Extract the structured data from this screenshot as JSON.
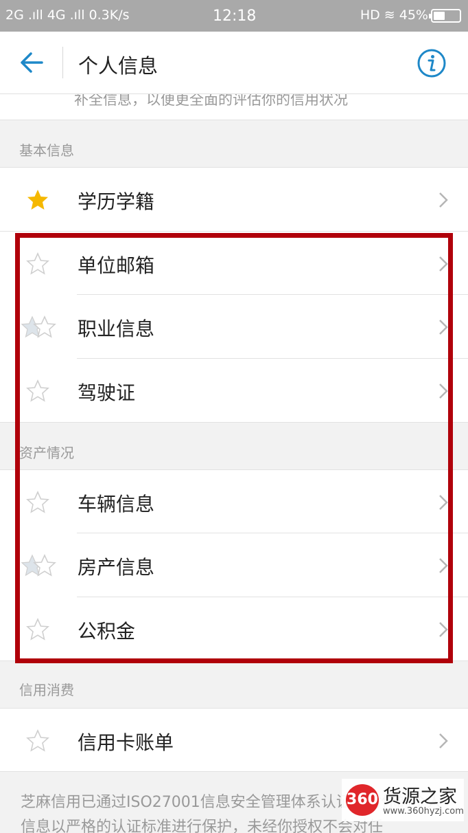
{
  "status_bar": {
    "left": "2G .ıll 4G .ıll 0.3K/s",
    "time": "12:18",
    "right": "HD ≋ 45%",
    "battery_level": 0.45
  },
  "nav": {
    "title": "个人信息"
  },
  "top_strip": {
    "text": "补全信息，以便更全面的评估你的信用状况"
  },
  "sections": {
    "basic": {
      "header": "基本信息",
      "items": [
        {
          "label": "学历学籍",
          "star": "filled"
        },
        {
          "label": "单位邮箱",
          "star": "outline"
        },
        {
          "label": "职业信息",
          "star": "double"
        },
        {
          "label": "驾驶证",
          "star": "outline"
        }
      ]
    },
    "assets": {
      "header": "资产情况",
      "items": [
        {
          "label": "车辆信息",
          "star": "outline"
        },
        {
          "label": "房产信息",
          "star": "double"
        },
        {
          "label": "公积金",
          "star": "outline"
        }
      ]
    },
    "credit": {
      "header": "信用消费",
      "items": [
        {
          "label": "信用卡账单",
          "star": "outline"
        }
      ]
    }
  },
  "footer": {
    "text": "芝麻信用已通过ISO27001信息安全管理体系认证，对你的个人信息以严格的认证标准进行保护，未经你授权不会对任"
  },
  "watermark": {
    "logo": "360",
    "title": "货源之家",
    "url": "www.360hyzj.com"
  },
  "colors": {
    "accent": "#1e88c8",
    "star_filled": "#f5b800",
    "highlight": "#b0000a"
  }
}
